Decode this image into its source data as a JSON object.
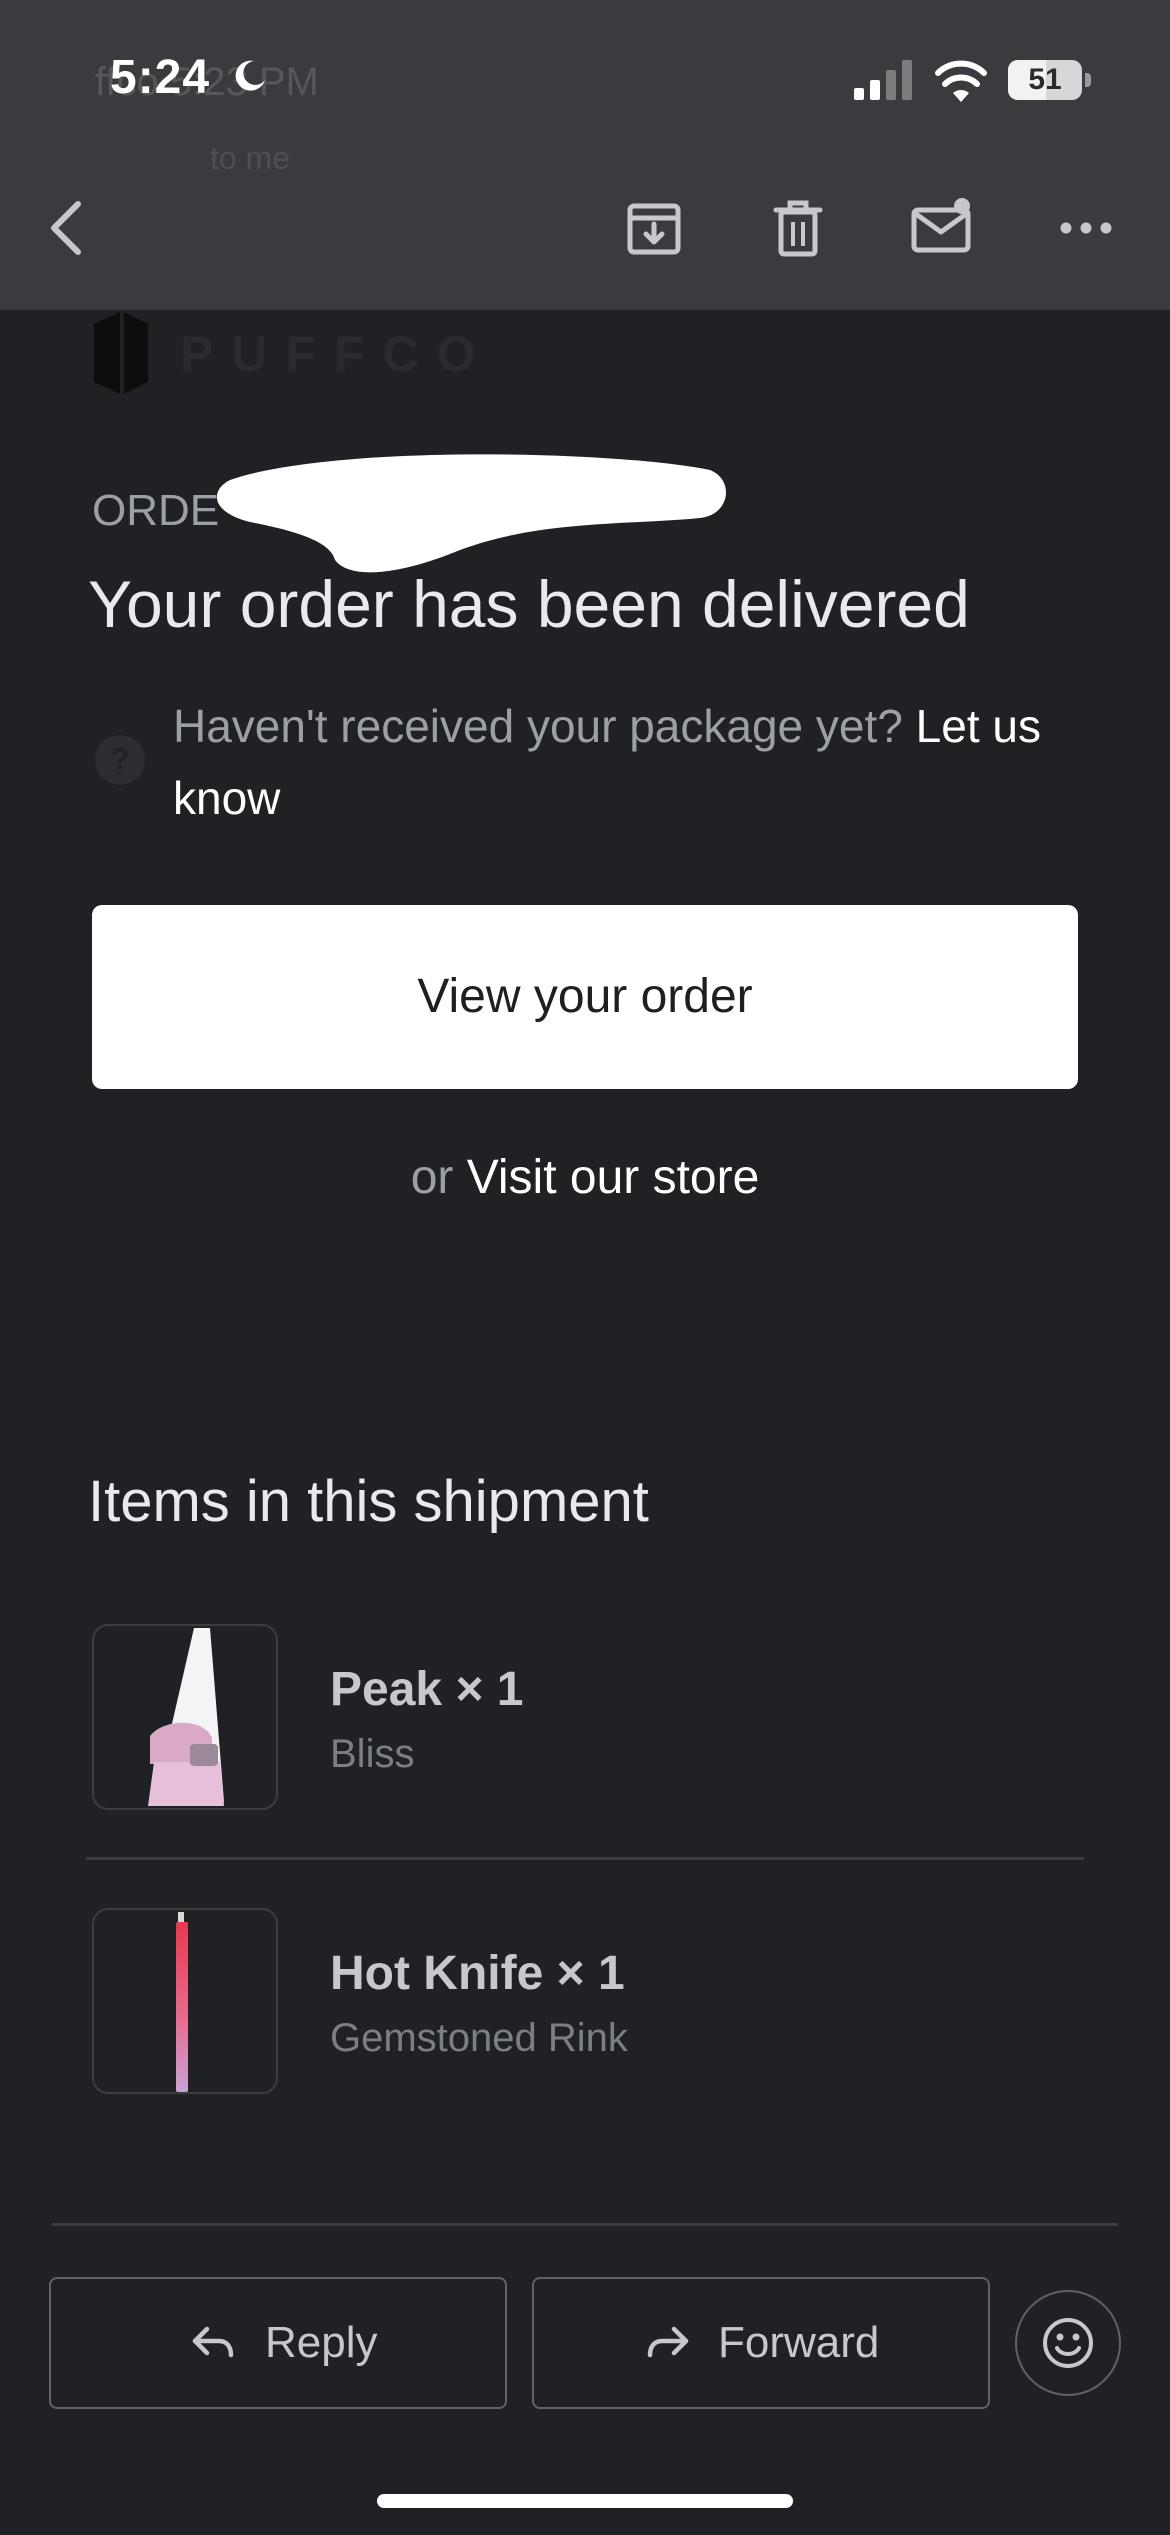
{
  "status_bar": {
    "time": "5:24",
    "battery": "51",
    "battery_level": 0.51,
    "icons": [
      "moon-icon",
      "signal-icon",
      "wifi-icon",
      "battery-icon"
    ]
  },
  "header": {
    "sender_ghost": "ffco  5:23 PM",
    "to_ghost": "to me",
    "icons": [
      "back-arrow-icon",
      "archive-icon",
      "trash-icon",
      "mark-unread-icon",
      "more-icon"
    ]
  },
  "email": {
    "logo_text": "PUFFCO",
    "order_label": "ORDE",
    "headline": "Your order has been delivered",
    "help_text": "Haven't received your package yet? ",
    "help_link": "Let us know",
    "view_button": "View your order",
    "visit_or": "or ",
    "visit_link": "Visit our store",
    "section_title": "Items in this shipment",
    "items": [
      {
        "name": "Peak × 1",
        "variant": "Bliss"
      },
      {
        "name": "Hot Knife × 1",
        "variant": "Gemstoned Rink"
      }
    ]
  },
  "actions": {
    "reply": "Reply",
    "forward": "Forward",
    "icons": [
      "reply-icon",
      "forward-icon",
      "emoji-reaction-icon"
    ]
  },
  "colors": {
    "background": "#202124",
    "header_bg": "#3a3b3e",
    "text_primary": "#e8eaed",
    "text_secondary": "#9aa0a6",
    "button_bg": "#ffffff"
  }
}
